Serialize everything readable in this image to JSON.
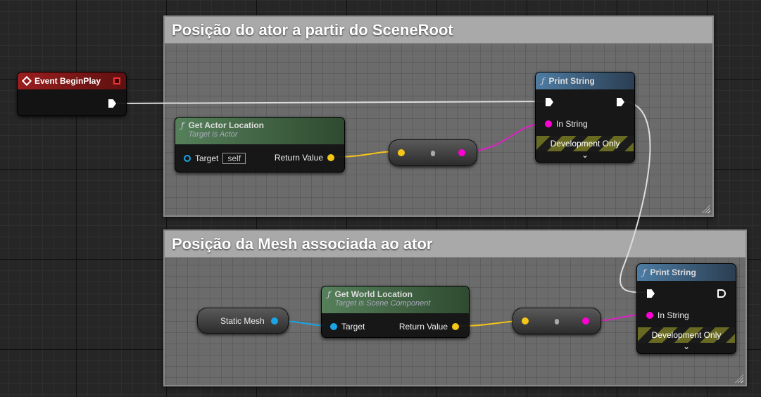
{
  "comments": [
    {
      "title": "Posição do ator a partir do SceneRoot"
    },
    {
      "title": "Posição da Mesh associada ao ator"
    }
  ],
  "event_begin_play": {
    "title": "Event BeginPlay"
  },
  "get_actor_location": {
    "title": "Get Actor Location",
    "subtitle": "Target is Actor",
    "target_label": "Target",
    "target_value": "self",
    "return_label": "Return Value"
  },
  "print_string_1": {
    "title": "Print String",
    "in_string": "In String",
    "dev_only": "Development Only"
  },
  "static_mesh": {
    "label": "Static Mesh"
  },
  "get_world_location": {
    "title": "Get World Location",
    "subtitle": "Target is Scene Component",
    "target_label": "Target",
    "return_label": "Return Value"
  },
  "print_string_2": {
    "title": "Print String",
    "in_string": "In String",
    "dev_only": "Development Only"
  },
  "colors": {
    "exec": "#ffffff",
    "vector": "#f5c518",
    "string": "#ff00d4",
    "object": "#1aa5e6",
    "event_header": "#8f1b1b",
    "function_header": "#4a6e4a",
    "print_header": "#3c5f7f"
  }
}
